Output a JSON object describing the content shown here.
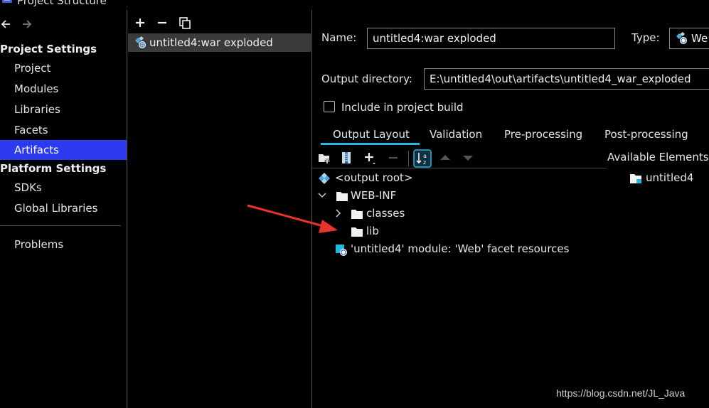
{
  "window": {
    "title": "Project Structure"
  },
  "colors": {
    "accent": "#2d3bf0",
    "tab_underline": "#26b7e6",
    "arrow": "#e8342c",
    "selection_row": "#3a3a3a"
  },
  "sidebar": {
    "back_icon": "arrow-left-icon",
    "forward_icon": "arrow-right-icon",
    "project_settings_header": "Project Settings",
    "project_settings_items": [
      {
        "label": "Project",
        "active": false
      },
      {
        "label": "Modules",
        "active": false
      },
      {
        "label": "Libraries",
        "active": false
      },
      {
        "label": "Facets",
        "active": false
      },
      {
        "label": "Artifacts",
        "active": true
      }
    ],
    "platform_settings_header": "Platform Settings",
    "platform_settings_items": [
      {
        "label": "SDKs"
      },
      {
        "label": "Global Libraries"
      }
    ],
    "problems_label": "Problems"
  },
  "artifacts_panel": {
    "toolbar": [
      "plus-icon",
      "minus-icon",
      "copy-icon"
    ],
    "items": [
      {
        "label": "untitled4:war exploded",
        "icon": "web-artifact-icon",
        "selected": true
      }
    ]
  },
  "artifact_detail": {
    "name_label": "Name:",
    "name_value": "untitled4:war exploded",
    "type_label": "Type:",
    "type_value": "We",
    "output_dir_label": "Output directory:",
    "output_dir_value": "E:\\untitled4\\out\\artifacts\\untitled4_war_exploded",
    "include_build_label": "Include in project build",
    "include_build_checked": false,
    "tabs": [
      {
        "label": "Output Layout",
        "active": true
      },
      {
        "label": "Validation",
        "active": false
      },
      {
        "label": "Pre-processing",
        "active": false
      },
      {
        "label": "Post-processing",
        "active": false
      }
    ],
    "layout_toolbar": [
      "new-folder-icon",
      "archive-icon",
      "add-icon",
      "remove-icon",
      "sort-icon",
      "move-up-icon",
      "move-down-icon"
    ],
    "tree": {
      "root": "<output root>",
      "web_inf": "WEB-INF",
      "classes": "classes",
      "lib": "lib",
      "facet_resources": "'untitled4' module: 'Web' facet resources"
    },
    "available_elements_label": "Available Elements (",
    "available_items": [
      {
        "label": "untitled4",
        "icon": "module-folder-icon"
      }
    ]
  },
  "watermark": "https://blog.csdn.net/JL_Java"
}
